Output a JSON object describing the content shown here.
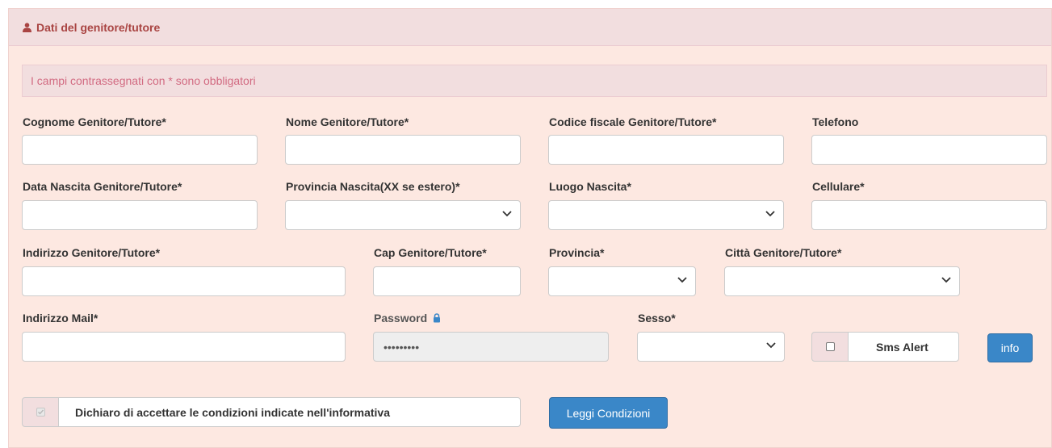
{
  "panel": {
    "title": "Dati del genitore/tutore",
    "notice": "I campi contrassegnati con * sono obbligatori"
  },
  "fields": {
    "cognome": {
      "label": "Cognome Genitore/Tutore*",
      "value": ""
    },
    "nome": {
      "label": "Nome Genitore/Tutore*",
      "value": ""
    },
    "codice_fiscale": {
      "label": "Codice fiscale Genitore/Tutore*",
      "value": ""
    },
    "telefono": {
      "label": "Telefono",
      "value": ""
    },
    "data_nascita": {
      "label": "Data Nascita Genitore/Tutore*",
      "value": ""
    },
    "provincia_nascita": {
      "label": "Provincia Nascita(XX se estero)*",
      "selected": ""
    },
    "luogo_nascita": {
      "label": "Luogo Nascita*",
      "selected": ""
    },
    "cellulare": {
      "label": "Cellulare*",
      "value": ""
    },
    "indirizzo": {
      "label": "Indirizzo Genitore/Tutore*",
      "value": ""
    },
    "cap": {
      "label": "Cap Genitore/Tutore*",
      "value": ""
    },
    "provincia": {
      "label": "Provincia*",
      "selected": ""
    },
    "citta": {
      "label": "Città Genitore/Tutore*",
      "selected": ""
    },
    "mail": {
      "label": "Indirizzo Mail*",
      "value": ""
    },
    "password": {
      "label": "Password",
      "value": "•••••••••"
    },
    "sesso": {
      "label": "Sesso*",
      "selected": ""
    }
  },
  "sms_alert": {
    "label": "Sms Alert",
    "checked": false
  },
  "buttons": {
    "info": "info",
    "leggi_condizioni": "Leggi Condizioni"
  },
  "consent": {
    "label": "Dichiaro di accettare le condizioni indicate nell'informativa",
    "checked": true
  },
  "colors": {
    "heading": "#a94442",
    "notice": "#d26b82",
    "button": "#3a87c8",
    "panel_bg": "#fde8e1"
  },
  "icons": {
    "heading": "user-icon",
    "password": "lock-icon",
    "select": "chevron-down-icon"
  }
}
